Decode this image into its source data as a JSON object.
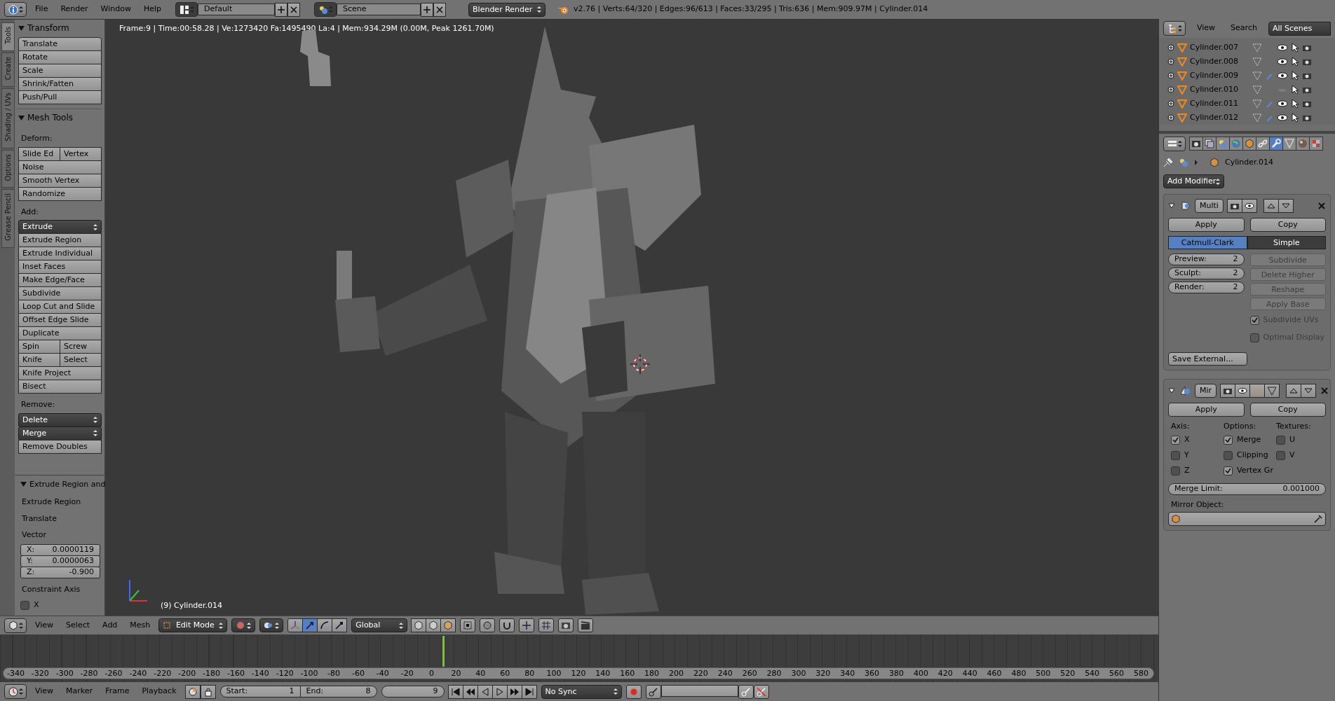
{
  "top_bar": {
    "menus": [
      "File",
      "Render",
      "Window",
      "Help"
    ],
    "layout": "Default",
    "scene": "Scene",
    "engine": "Blender Render",
    "stats": "v2.76 | Verts:64/320 | Edges:96/613 | Faces:33/295 | Tris:636 | Mem:909.97M | Cylinder.014"
  },
  "shelf_tabs": [
    {
      "label": "Tools",
      "selected": true
    },
    {
      "label": "Create",
      "selected": false
    },
    {
      "label": "Shading / UVs",
      "selected": false
    },
    {
      "label": "Options",
      "selected": false
    },
    {
      "label": "Grease Pencil",
      "selected": false
    }
  ],
  "shelf_panels": [
    {
      "title": "Transform",
      "items": [
        {
          "kind": "buttons",
          "labels": [
            "Translate"
          ]
        },
        {
          "kind": "buttons",
          "labels": [
            "Rotate"
          ]
        },
        {
          "kind": "buttons",
          "labels": [
            "Scale"
          ]
        },
        {
          "kind": "buttons",
          "labels": [
            "Shrink/Fatten"
          ]
        },
        {
          "kind": "buttons",
          "labels": [
            "Push/Pull"
          ]
        }
      ]
    },
    {
      "title": "Mesh Tools",
      "items": [
        {
          "kind": "label",
          "text": "Deform:"
        },
        {
          "kind": "buttons",
          "labels": [
            "Slide Ed",
            "Vertex"
          ]
        },
        {
          "kind": "buttons",
          "labels": [
            "Noise"
          ]
        },
        {
          "kind": "buttons",
          "labels": [
            "Smooth Vertex"
          ]
        },
        {
          "kind": "buttons",
          "labels": [
            "Randomize"
          ]
        },
        {
          "kind": "label",
          "text": "Add:"
        },
        {
          "kind": "dropdown",
          "text": "Extrude"
        },
        {
          "kind": "buttons",
          "labels": [
            "Extrude Region"
          ]
        },
        {
          "kind": "buttons",
          "labels": [
            "Extrude Individual"
          ]
        },
        {
          "kind": "buttons",
          "labels": [
            "Inset Faces"
          ]
        },
        {
          "kind": "buttons",
          "labels": [
            "Make Edge/Face"
          ]
        },
        {
          "kind": "buttons",
          "labels": [
            "Subdivide"
          ]
        },
        {
          "kind": "buttons",
          "labels": [
            "Loop Cut and Slide"
          ]
        },
        {
          "kind": "buttons",
          "labels": [
            "Offset Edge Slide"
          ]
        },
        {
          "kind": "buttons",
          "labels": [
            "Duplicate"
          ]
        },
        {
          "kind": "buttons",
          "labels": [
            "Spin",
            "Screw"
          ]
        },
        {
          "kind": "buttons",
          "labels": [
            "Knife",
            "Select"
          ]
        },
        {
          "kind": "buttons",
          "labels": [
            "Knife Project"
          ]
        },
        {
          "kind": "buttons",
          "labels": [
            "Bisect"
          ]
        },
        {
          "kind": "label",
          "text": "Remove:"
        },
        {
          "kind": "dropdown",
          "text": "Delete"
        },
        {
          "kind": "dropdown",
          "text": "Merge"
        },
        {
          "kind": "buttons",
          "labels": [
            "Remove Doubles"
          ]
        }
      ]
    }
  ],
  "operator_panel": {
    "title": "Extrude Region and",
    "items": [
      {
        "kind": "label",
        "text": "Extrude Region"
      },
      {
        "kind": "label",
        "text": "Translate"
      },
      {
        "kind": "label",
        "text": "Vector"
      },
      {
        "kind": "vector",
        "fields": [
          {
            "label": "X:",
            "value": "0.0000119"
          },
          {
            "label": "Y:",
            "value": "0.0000063"
          },
          {
            "label": "Z:",
            "value": "-0.900"
          }
        ]
      },
      {
        "kind": "label",
        "text": "Constraint Axis"
      },
      {
        "kind": "checkbox",
        "label": "X",
        "checked": false
      }
    ]
  },
  "viewport": {
    "info": "Frame:9 | Time:00:58.28 | Ve:1273420 Fa:1495490 La:4 | Mem:934.29M (0.00M, Peak 1261.70M)",
    "object_label": "(9) Cylinder.014"
  },
  "view3d_header": {
    "menus": [
      "View",
      "Select",
      "Add",
      "Mesh"
    ],
    "mode": "Edit Mode",
    "manipulators": [
      {
        "kind": "translate",
        "selected": true
      },
      {
        "kind": "rotate",
        "selected": false
      },
      {
        "kind": "scale",
        "selected": false
      }
    ],
    "orientation": "Global"
  },
  "timeline": {
    "ruler_labels": [
      "-340",
      "-320",
      "-300",
      "-280",
      "-260",
      "-240",
      "-220",
      "-200",
      "-180",
      "-160",
      "-140",
      "-120",
      "-100",
      "-80",
      "-60",
      "-40",
      "-20",
      "0",
      "20",
      "40",
      "60",
      "80",
      "100",
      "120",
      "140",
      "160",
      "180",
      "200",
      "220",
      "240",
      "260",
      "280",
      "300",
      "320",
      "340",
      "360",
      "380",
      "400",
      "420",
      "440",
      "460",
      "480",
      "500",
      "520",
      "540",
      "560",
      "580"
    ]
  },
  "timeline_header": {
    "menus": [
      "View",
      "Marker",
      "Frame",
      "Playback"
    ],
    "start": {
      "label": "Start:",
      "value": "1"
    },
    "end": {
      "label": "End:",
      "value": "8"
    },
    "current": "9",
    "sync": "No Sync"
  },
  "outliner": {
    "menus": [
      "View",
      "Search"
    ],
    "filter": "All Scenes",
    "items": [
      {
        "name": "Cylinder.007",
        "visible": true,
        "has_modifier": false
      },
      {
        "name": "Cylinder.008",
        "visible": true,
        "has_modifier": false
      },
      {
        "name": "Cylinder.009",
        "visible": true,
        "has_modifier": true
      },
      {
        "name": "Cylinder.010",
        "visible": false,
        "has_modifier": false
      },
      {
        "name": "Cylinder.011",
        "visible": true,
        "has_modifier": true
      },
      {
        "name": "Cylinder.012",
        "visible": true,
        "has_modifier": true
      }
    ]
  },
  "properties": {
    "tabs": [
      {
        "kind": "render",
        "selected": false
      },
      {
        "kind": "layers",
        "selected": false
      },
      {
        "kind": "scene",
        "selected": false
      },
      {
        "kind": "world",
        "selected": false
      },
      {
        "kind": "object",
        "selected": false
      },
      {
        "kind": "constraints",
        "selected": false
      },
      {
        "kind": "modifiers",
        "selected": true
      },
      {
        "kind": "data",
        "selected": false
      },
      {
        "kind": "material",
        "selected": false
      },
      {
        "kind": "texture",
        "selected": false
      }
    ],
    "object": "Cylinder.014",
    "add_modifier": "Add Modifier",
    "modifiers": [
      {
        "kind": "multires",
        "name": "Multi",
        "expanded": true,
        "apply": "Apply",
        "copy": "Copy",
        "types": [
          {
            "label": "Catmull-Clark",
            "selected": true
          },
          {
            "label": "Simple",
            "selected": false
          }
        ],
        "levels": [
          {
            "label": "Preview:",
            "value": "2"
          },
          {
            "label": "Sculpt:",
            "value": "2"
          },
          {
            "label": "Render:",
            "value": "2"
          }
        ],
        "actions": [
          {
            "label": "Subdivide",
            "disabled": true
          },
          {
            "label": "Delete Higher",
            "disabled": true
          },
          {
            "label": "Reshape",
            "disabled": true
          },
          {
            "label": "Apply Base",
            "disabled": true
          }
        ],
        "options": [
          {
            "label": "Subdivide UVs",
            "checked": true,
            "disabled": true
          },
          {
            "label": "Optimal Display",
            "checked": false,
            "disabled": true
          }
        ],
        "save": "Save External..."
      },
      {
        "kind": "mirror",
        "name": "Mir",
        "expanded": true,
        "apply": "Apply",
        "copy": "Copy",
        "columns": [
          {
            "title": "Axis:",
            "checks": [
              {
                "label": "X",
                "checked": true
              },
              {
                "label": "Y",
                "checked": false
              },
              {
                "label": "Z",
                "checked": false
              }
            ]
          },
          {
            "title": "Options:",
            "checks": [
              {
                "label": "Merge",
                "checked": true
              },
              {
                "label": "Clipping",
                "checked": false
              },
              {
                "label": "Vertex Gr",
                "checked": true
              }
            ]
          },
          {
            "title": "Textures:",
            "checks": [
              {
                "label": "U",
                "checked": false
              },
              {
                "label": "V",
                "checked": false
              }
            ]
          }
        ],
        "merge_limit": {
          "label": "Merge Limit:",
          "value": "0.001000"
        },
        "mirror_object_label": "Mirror Object:"
      }
    ]
  }
}
